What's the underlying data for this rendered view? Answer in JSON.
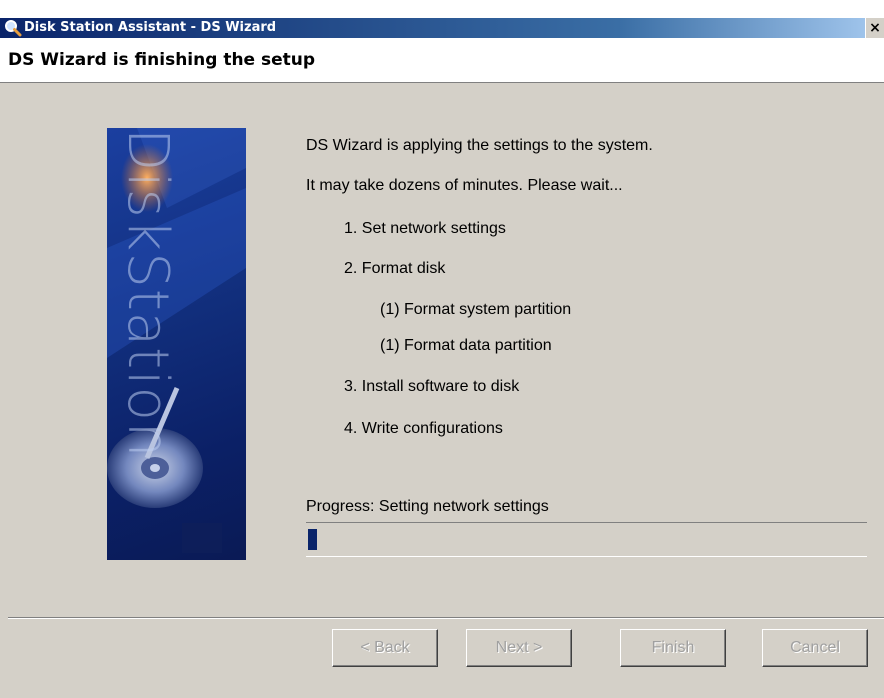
{
  "window": {
    "title": "Disk Station Assistant - DS Wizard",
    "close_symbol": "×"
  },
  "header": {
    "title": "DS Wizard is finishing the setup"
  },
  "banner": {
    "brand_text": "DiskStation"
  },
  "main": {
    "line1": "DS Wizard is applying the settings to the system.",
    "line2": "It may take dozens of minutes. Please wait...",
    "steps": [
      "1. Set network settings",
      "2. Format disk",
      "(1) Format system partition",
      "(1) Format data partition",
      "3. Install software to disk",
      "4. Write configurations"
    ]
  },
  "progress": {
    "label": "Progress: Setting network settings",
    "value_percent": 3,
    "color": "#0a246a"
  },
  "buttons": {
    "back": "< Back",
    "next": "Next >",
    "finish": "Finish",
    "cancel": "Cancel"
  },
  "icons": {
    "title_icon": "magnifier-icon",
    "close_icon": "close-icon"
  }
}
